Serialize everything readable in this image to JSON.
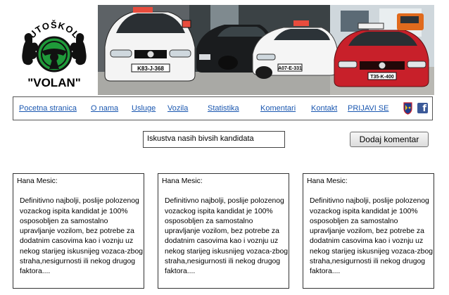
{
  "logo": {
    "top_text": "AUTOŠKOLA",
    "bottom_text": "\"VOLAN\""
  },
  "photo": {
    "plates": [
      "K83-J-368",
      "A07-E-331",
      "T35-K-400"
    ]
  },
  "nav": {
    "items": [
      {
        "label": "Pocetna stranica"
      },
      {
        "label": "O nama"
      },
      {
        "label": "Usluge"
      },
      {
        "label": "Vozila"
      },
      {
        "label": "Statistika"
      },
      {
        "label": "Komentari"
      },
      {
        "label": "Kontakt"
      },
      {
        "label": "PRIJAVI SE"
      }
    ],
    "facebook_icon": "facebook-icon",
    "crest_icon": "coat-of-arms-icon"
  },
  "section": {
    "title": "Iskustva nasih bivsih kandidata",
    "add_button": "Dodaj komentar"
  },
  "comments": [
    {
      "author": "Hana Mesic:",
      "text": "Definitivno najbolji, poslije polozenog vozackog ispita kandidat je 100% osposobljen za samostalno upravljanje vozilom, bez potrebe za dodatnim casovima kao i voznju uz nekog starijeg iskusnijeg vozaca-zbog straha,nesigurnosti ili nekog drugog faktora...."
    },
    {
      "author": "Hana Mesic:",
      "text": "Definitivno najbolji, poslije polozenog vozackog ispita kandidat je 100% osposobljen za samostalno upravljanje vozilom, bez potrebe za dodatnim casovima kao i voznju uz nekog starijeg iskusnijeg vozaca-zbog straha,nesigurnosti ili nekog drugog faktora...."
    },
    {
      "author": "Hana Mesic:",
      "text": "Definitivno najbolji, poslije polozenog vozackog ispita kandidat je 100% osposobljen za samostalno upravljanje vozilom, bez potrebe za dodatnim casovima kao i voznju uz nekog starijeg iskusnijeg vozaca-zbog straha,nesigurnosti ili nekog drugog faktora...."
    }
  ],
  "colors": {
    "link": "#1a57b0",
    "logo_green": "#1f9a3a",
    "car_red": "#c8202a",
    "facebook": "#3b5998"
  }
}
